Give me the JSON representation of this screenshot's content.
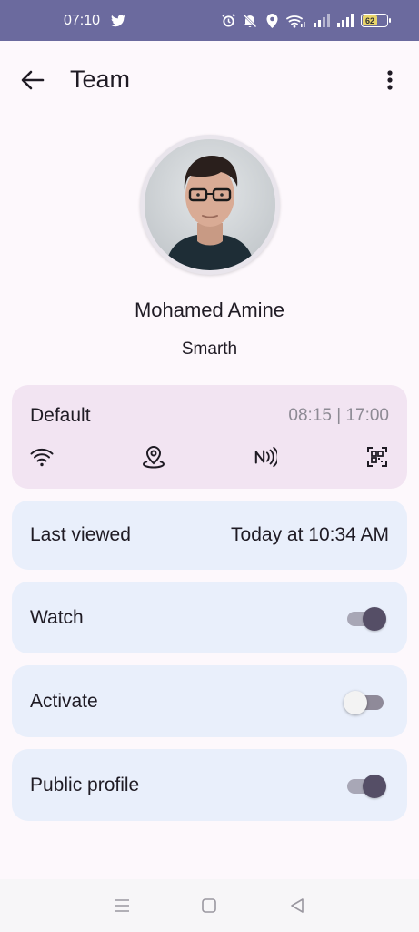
{
  "status_bar": {
    "time": "07:10",
    "battery": "62",
    "icons": [
      "twitter-icon",
      "alarm-icon",
      "mute-icon",
      "location-icon",
      "wifi-icon",
      "signal-icon",
      "signal-icon",
      "battery-icon"
    ]
  },
  "app_bar": {
    "title": "Team",
    "back_icon": "arrow-left-icon",
    "menu_icon": "more-vert-icon"
  },
  "profile": {
    "name": "Mohamed Amine",
    "company": "Smarth"
  },
  "schedule": {
    "title": "Default",
    "hours": "08:15 | 17:00",
    "icons": [
      "wifi-icon",
      "location-pin-icon",
      "nfc-icon",
      "qr-scan-icon"
    ]
  },
  "last_viewed": {
    "label": "Last viewed",
    "value": "Today at 10:34 AM"
  },
  "toggles": {
    "watch": {
      "label": "Watch",
      "on": true
    },
    "activate": {
      "label": "Activate",
      "on": false
    },
    "public_profile": {
      "label": "Public profile",
      "on": true
    }
  },
  "nav_bar": {
    "icons": [
      "menu-icon",
      "home-square-icon",
      "back-triangle-icon"
    ]
  },
  "colors": {
    "status_bar": "#6b6a9e",
    "background": "#fdf8fc",
    "schedule_card": "#f2e4f2",
    "card": "#e9effb",
    "switch_thumb_on": "#554e66"
  }
}
